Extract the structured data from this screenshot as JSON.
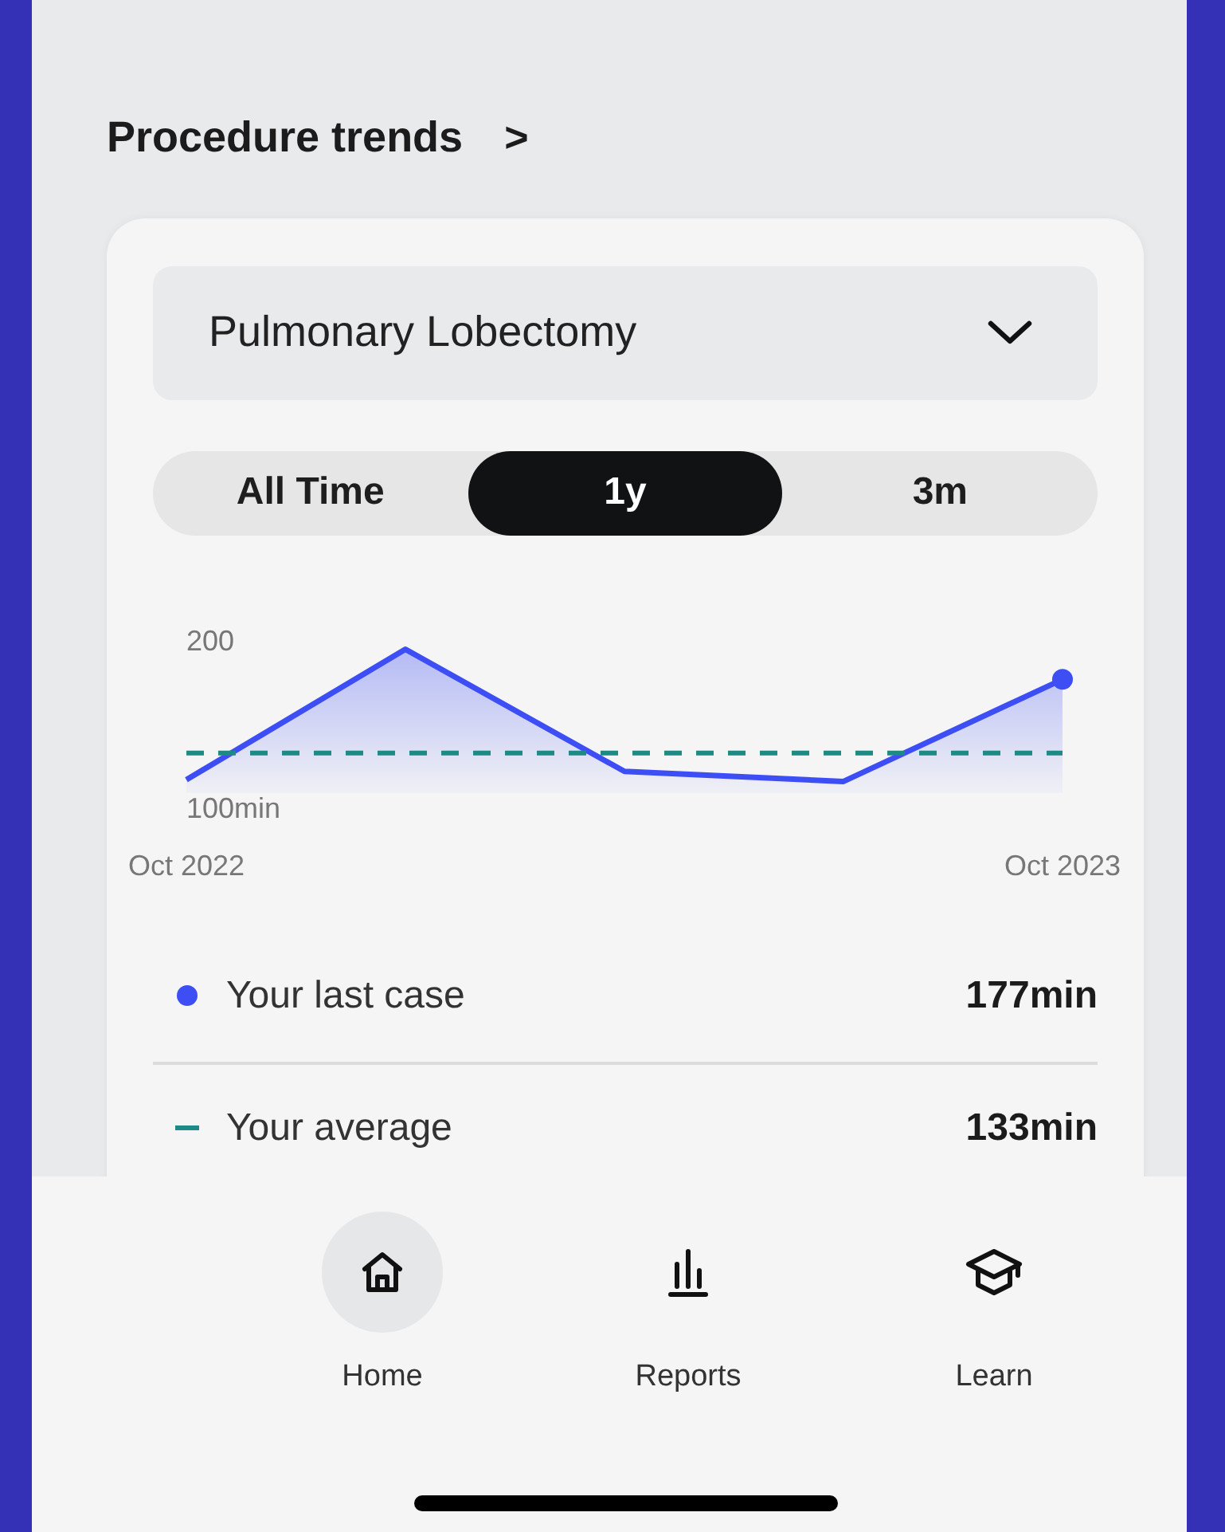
{
  "section": {
    "title": "Procedure trends",
    "chevron": ">"
  },
  "procedure_select": {
    "value": "Pulmonary Lobectomy"
  },
  "range_tabs": [
    {
      "label": "All Time",
      "selected": false
    },
    {
      "label": "1y",
      "selected": true
    },
    {
      "label": "3m",
      "selected": false
    }
  ],
  "chart_data": {
    "type": "line",
    "categories": [
      "Oct 2022",
      null,
      null,
      null,
      "Oct 2023"
    ],
    "yticks": [
      {
        "value": 200,
        "label": "200"
      },
      {
        "value": 100,
        "label": "100min"
      }
    ],
    "ylim": [
      100,
      200
    ],
    "series": [
      {
        "name": "Your last case",
        "color": "#3d4ef5",
        "values": [
          117,
          195,
          122,
          116,
          177
        ]
      },
      {
        "name": "Your average",
        "color": "#1e8a86",
        "line_style": "dashed",
        "values": [
          133,
          133,
          133,
          133,
          133
        ]
      }
    ]
  },
  "legend": [
    {
      "kind": "dot",
      "value": "177min"
    },
    {
      "kind": "dash",
      "value": "133min"
    }
  ],
  "nav": [
    {
      "label": "Home",
      "kind": "home",
      "selected": true
    },
    {
      "label": "Reports",
      "kind": "reports",
      "selected": false
    },
    {
      "label": "Learn",
      "kind": "learn",
      "selected": false
    }
  ]
}
